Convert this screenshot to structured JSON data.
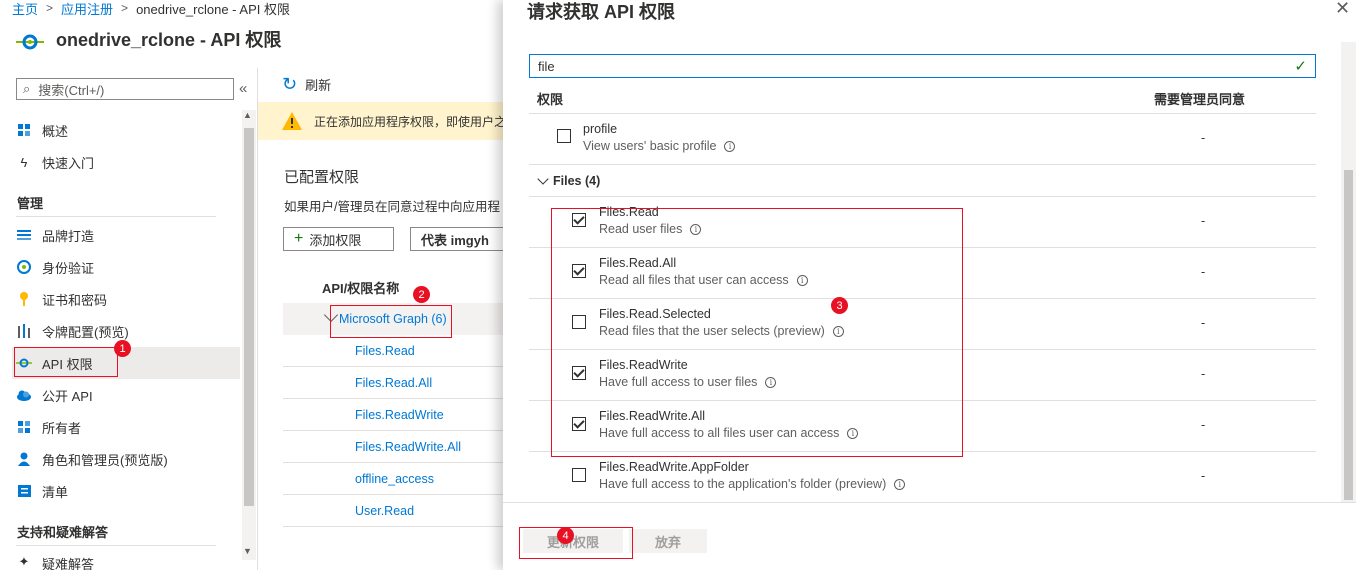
{
  "breadcrumb": [
    "主页",
    "应用注册",
    "onedrive_rclone - API 权限"
  ],
  "page_title": "onedrive_rclone - API 权限",
  "nav": {
    "search_placeholder": "搜索(Ctrl+/)",
    "items_top": [
      {
        "label": "概述",
        "icon": "grid-icon"
      },
      {
        "label": "快速入门",
        "icon": "lightning-icon"
      }
    ],
    "section_manage": "管理",
    "items_manage": [
      {
        "label": "品牌打造",
        "icon": "branding-icon"
      },
      {
        "label": "身份验证",
        "icon": "authentication-icon"
      },
      {
        "label": "证书和密码",
        "icon": "key-icon"
      },
      {
        "label": "令牌配置(预览)",
        "icon": "token-config-icon"
      },
      {
        "label": "API 权限",
        "icon": "api-permissions-icon",
        "active": true
      },
      {
        "label": "公开 API",
        "icon": "cloud-icon"
      },
      {
        "label": "所有者",
        "icon": "owners-icon"
      },
      {
        "label": "角色和管理员(预览版)",
        "icon": "roles-icon"
      },
      {
        "label": "清单",
        "icon": "manifest-icon"
      }
    ],
    "section_support": "支持和疑难解答",
    "items_support_partial": "疑难解答"
  },
  "middle": {
    "refresh_label": "刷新",
    "warning_text": "正在添加应用程序权限，即使用户之",
    "configured_title": "已配置权限",
    "configured_desc": "如果用户/管理员在同意过程中向应用程",
    "add_permission_label": "添加权限",
    "grant_label": "代表 imgyh",
    "api_col_header": "API/权限名称",
    "group_label": "Microsoft Graph (6)",
    "permissions": [
      "Files.Read",
      "Files.Read.All",
      "Files.ReadWrite",
      "Files.ReadWrite.All",
      "offline_access",
      "User.Read"
    ]
  },
  "panel": {
    "title": "请求获取 API 权限",
    "filter_value": "file",
    "col_permission": "权限",
    "col_admin_consent": "需要管理员同意",
    "profile": {
      "name": "profile",
      "desc": "View users' basic profile",
      "admin": "-",
      "checked": false
    },
    "files_group_label": "Files (4)",
    "file_permissions": [
      {
        "name": "Files.Read",
        "desc": "Read user files",
        "admin": "-",
        "checked": true
      },
      {
        "name": "Files.Read.All",
        "desc": "Read all files that user can access",
        "admin": "-",
        "checked": true
      },
      {
        "name": "Files.Read.Selected",
        "desc": "Read files that the user selects (preview)",
        "admin": "-",
        "checked": false
      },
      {
        "name": "Files.ReadWrite",
        "desc": "Have full access to user files",
        "admin": "-",
        "checked": true
      },
      {
        "name": "Files.ReadWrite.All",
        "desc": "Have full access to all files user can access",
        "admin": "-",
        "checked": true
      },
      {
        "name": "Files.ReadWrite.AppFolder",
        "desc": "Have full access to the application's folder (preview)",
        "admin": "-",
        "checked": false
      }
    ],
    "update_label": "更新权限",
    "discard_label": "放弃"
  },
  "annotations": [
    "1",
    "2",
    "3",
    "4"
  ]
}
